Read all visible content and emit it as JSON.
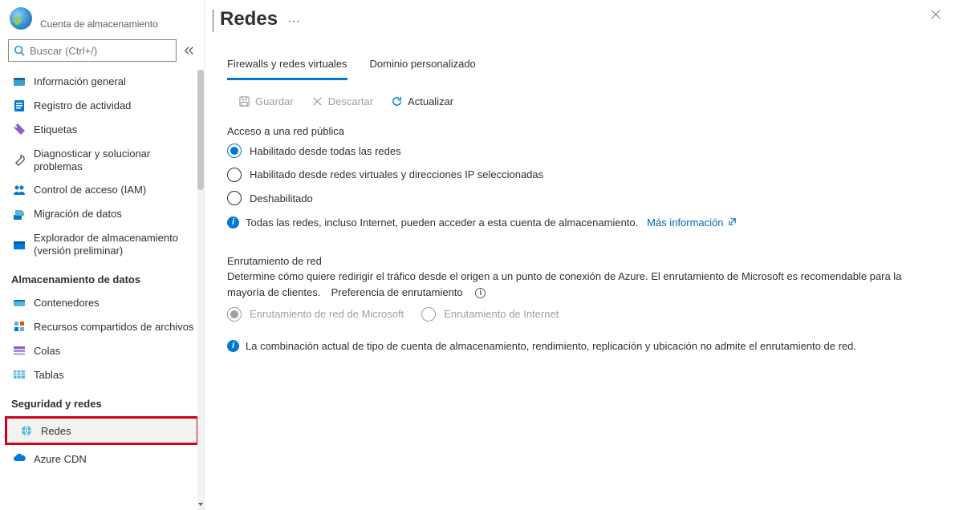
{
  "sidebar": {
    "subtitle": "Cuenta de almacenamiento",
    "search_placeholder": "Buscar (Ctrl+/)",
    "items": [
      {
        "label": "Información general"
      },
      {
        "label": "Registro de actividad"
      },
      {
        "label": "Etiquetas"
      },
      {
        "label": "Diagnosticar y solucionar problemas"
      },
      {
        "label": "Control de acceso (IAM)"
      },
      {
        "label": "Migración de datos"
      },
      {
        "label": "Explorador de almacenamiento (versión preliminar)"
      }
    ],
    "section_data": "Almacenamiento de datos",
    "data_items": [
      {
        "label": "Contenedores"
      },
      {
        "label": "Recursos compartidos de archivos"
      },
      {
        "label": "Colas"
      },
      {
        "label": "Tablas"
      }
    ],
    "section_security": "Seguridad y redes",
    "security_items": [
      {
        "label": "Redes"
      },
      {
        "label": "Azure CDN"
      }
    ]
  },
  "page": {
    "title": "Redes",
    "tabs": {
      "t1": "Firewalls y redes virtuales",
      "t2": "Dominio personalizado"
    },
    "toolbar": {
      "save": "Guardar",
      "discard": "Descartar",
      "refresh": "Actualizar"
    },
    "public_access": {
      "heading": "Acceso a una red pública",
      "opt1": "Habilitado desde todas las redes",
      "opt2": "Habilitado desde redes virtuales y direcciones IP seleccionadas",
      "opt3": "Deshabilitado",
      "info": "Todas las redes, incluso Internet, pueden acceder a esta cuenta de almacenamiento.",
      "info_link": "Más información"
    },
    "routing": {
      "heading": "Enrutamiento de red",
      "desc": "Determine cómo quiere redirigir el tráfico desde el origen a un punto de conexión de Azure. El enrutamiento de Microsoft es recomendable para la mayoría de clientes.",
      "pref_label": "Preferencia de enrutamiento",
      "opt1": "Enrutamiento de red de Microsoft",
      "opt2": "Enrutamiento de Internet",
      "info": "La combinación actual de tipo de cuenta de almacenamiento, rendimiento, replicación y ubicación no admite el enrutamiento de red."
    }
  }
}
